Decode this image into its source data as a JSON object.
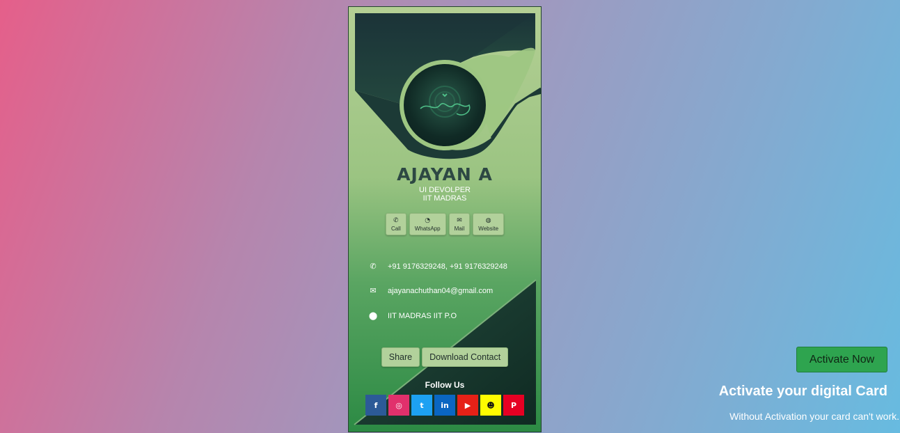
{
  "card": {
    "logo_text": "Ajayan",
    "name": "AJAYAN A",
    "role": "UI DEVOLPER",
    "org": "IIT MADRAS",
    "actions": [
      {
        "label": "Call",
        "icon": "phone-icon"
      },
      {
        "label": "WhatsApp",
        "icon": "whatsapp-icon"
      },
      {
        "label": "Mail",
        "icon": "mail-icon"
      },
      {
        "label": "Website",
        "icon": "globe-icon"
      }
    ],
    "contact": {
      "phone": "+91 9176329248, +91 9176329248",
      "email": "ajayanachuthan04@gmail.com",
      "address": "IIT MADRAS IIT P.O"
    },
    "share_label": "Share",
    "download_label": "Download Contact",
    "follow_label": "Follow Us",
    "socials": [
      {
        "name": "facebook",
        "glyph": "f",
        "color": "#2c5a97"
      },
      {
        "name": "instagram",
        "glyph": "◎",
        "color": "#e1306c"
      },
      {
        "name": "twitter",
        "glyph": "t",
        "color": "#1da1f2"
      },
      {
        "name": "linkedin",
        "glyph": "in",
        "color": "#0a66c2"
      },
      {
        "name": "youtube",
        "glyph": "▶",
        "color": "#e62117"
      },
      {
        "name": "snapchat",
        "glyph": "☻",
        "color": "#fffc00"
      },
      {
        "name": "pinterest",
        "glyph": "P",
        "color": "#e60023"
      }
    ],
    "colors": {
      "card_dark": "#1d3a3a",
      "card_light": "#b4cf94",
      "button_bg": "#b2d19b"
    }
  },
  "activation": {
    "button_label": "Activate Now",
    "title": "Activate your digital Card",
    "subtitle": "Without Activation your card can't work.",
    "button_color": "#2ea44f"
  }
}
